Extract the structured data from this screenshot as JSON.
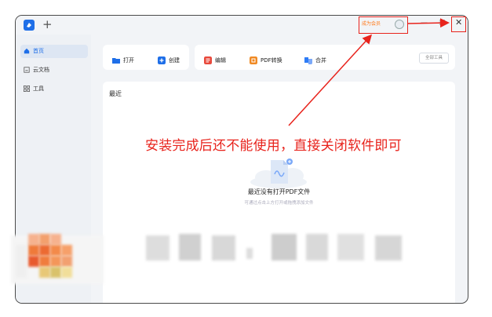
{
  "titlebar": {
    "new_tab": "+",
    "member_label": "成为会员",
    "minimize": "—",
    "maximize": "□",
    "close": "✕"
  },
  "sidebar": {
    "items": [
      {
        "label": "首页",
        "icon": "home-icon",
        "active": true
      },
      {
        "label": "云文档",
        "icon": "cloud-doc-icon",
        "active": false
      },
      {
        "label": "工具",
        "icon": "grid-icon",
        "active": false
      }
    ]
  },
  "toolbar": {
    "open_label": "打开",
    "create_label": "创建",
    "edit_label": "编辑",
    "convert_label": "PDF转换",
    "merge_label": "合并",
    "manage_label": "全部工具"
  },
  "main": {
    "section_title": "最近",
    "empty_title": "最近没有打开PDF文件",
    "empty_subtitle": "可通过点击上方打开或拖拽添加文件"
  },
  "annotation": {
    "text": "安装完成后还不能使用，直接关闭软件即可",
    "color": "#e8231c"
  },
  "colors": {
    "accent": "#1f6fe8",
    "member": "#ff7a1a",
    "edit_icon": "#e8483b",
    "convert_icon": "#f08a24",
    "merge_icon": "#2e7cf6"
  }
}
